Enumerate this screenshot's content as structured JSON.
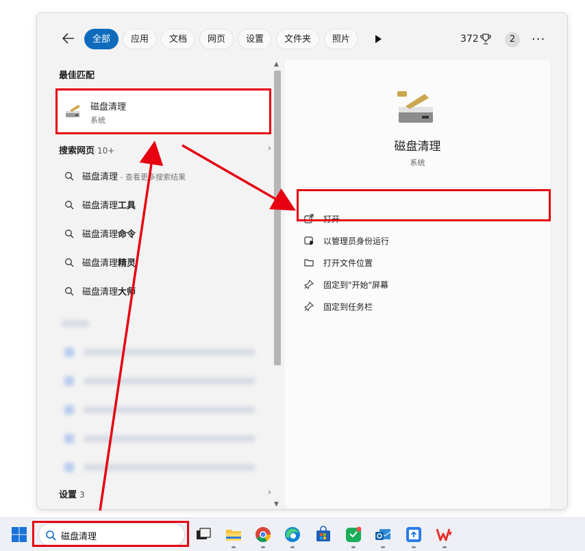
{
  "header": {
    "tabs": [
      {
        "label": "全部",
        "active": true
      },
      {
        "label": "应用"
      },
      {
        "label": "文档"
      },
      {
        "label": "网页"
      },
      {
        "label": "设置"
      },
      {
        "label": "文件夹"
      },
      {
        "label": "照片"
      }
    ],
    "points": "372",
    "badge": "2",
    "more": "···"
  },
  "left": {
    "best_match_title": "最佳匹配",
    "best_match": {
      "name": "磁盘清理",
      "type": "系统"
    },
    "web_title": "搜索网页",
    "web_count": "10+",
    "suggestions": [
      {
        "bold": "磁盘清理",
        "rest": "",
        "hint": " - 查看更多搜索结果"
      },
      {
        "bold": "磁盘清理",
        "rest": "工具",
        "hint": ""
      },
      {
        "bold": "磁盘清理",
        "rest": "命令",
        "hint": ""
      },
      {
        "bold": "磁盘清理",
        "rest": "精灵",
        "hint": ""
      },
      {
        "bold": "磁盘清理",
        "rest": "大师",
        "hint": ""
      }
    ],
    "settings_title": "设置",
    "settings_count": "3"
  },
  "right": {
    "app_name": "磁盘清理",
    "app_type": "系统",
    "actions": [
      {
        "label": "打开",
        "icon": "open-external-icon"
      },
      {
        "label": "以管理员身份运行",
        "icon": "shield-icon"
      },
      {
        "label": "打开文件位置",
        "icon": "folder-icon"
      },
      {
        "label": "固定到\"开始\"屏幕",
        "icon": "pin-icon"
      },
      {
        "label": "固定到任务栏",
        "icon": "pin-icon"
      }
    ]
  },
  "taskbar": {
    "search_value": "磁盘清理",
    "apps": [
      "task-view-icon",
      "file-explorer-icon",
      "chrome-icon",
      "edge-icon",
      "store-icon",
      "wechat-work-icon",
      "outlook-icon",
      "upload-app-icon",
      "wps-icon"
    ]
  },
  "colors": {
    "accent": "#0f6cbd",
    "annotation_red": "#e60012"
  }
}
